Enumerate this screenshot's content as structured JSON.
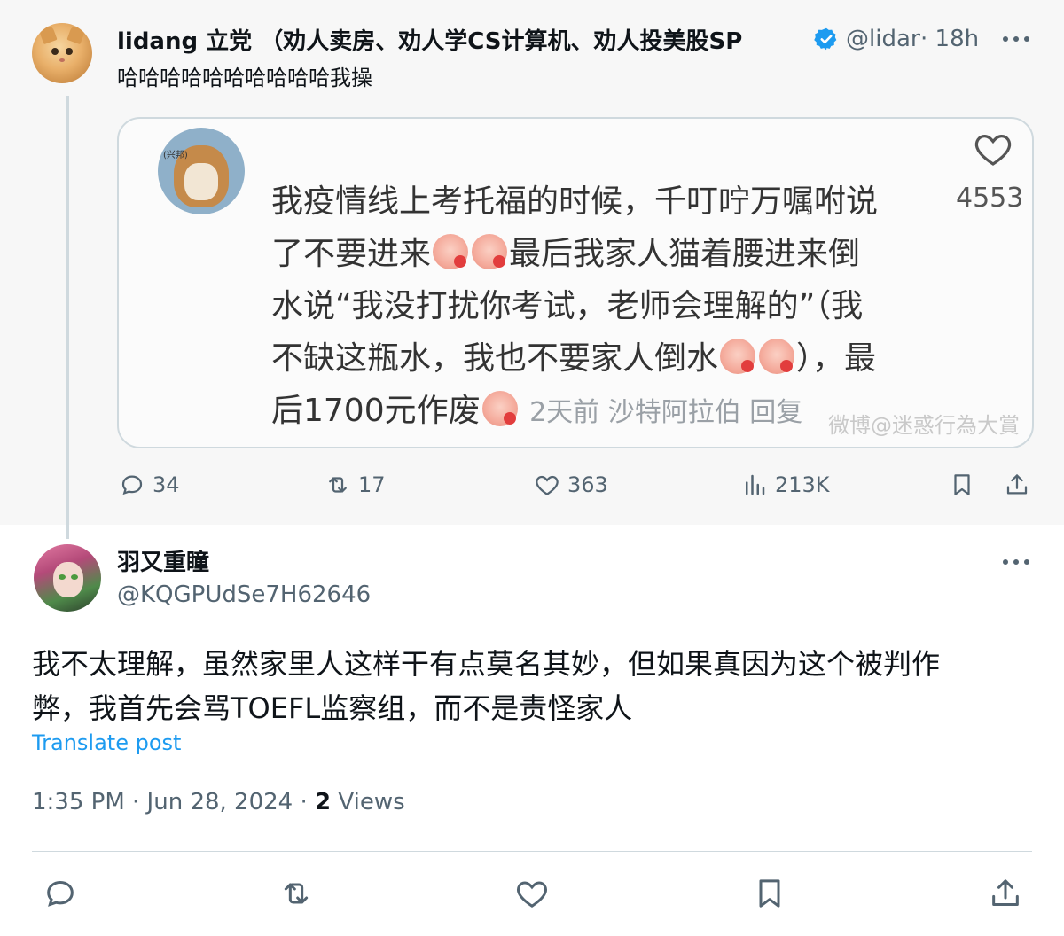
{
  "parent_tweet": {
    "display_name": "lidang 立党 （劝人卖房、劝人学CS计算机、劝人投美股SP",
    "handle": "@lidang",
    "time": "· 18h",
    "text": "哈哈哈哈哈哈哈哈哈哈我操",
    "media": {
      "avatar_tag": "(兴邦)",
      "line1": "我疫情线上考托福的时候，千叮咛万嘱咐说",
      "line2a": "了不要进来",
      "line2b": "最后我家人猫着腰进来倒",
      "line3": "水说“我没打扰你考试，老师会理解的”（我",
      "line4a": "不缺这瓶水，我也不要家人倒水",
      "line4b": "），最",
      "line5a": "后1700元作废",
      "line5_meta": "2天前 沙特阿拉伯 回复",
      "like_count": "4553",
      "watermark": "微博@迷惑行為大賞"
    },
    "stats": {
      "replies": "34",
      "reposts": "17",
      "likes": "363",
      "views": "213K"
    }
  },
  "reply_tweet": {
    "display_name": "羽又重瞳",
    "handle": "@KQGPUdSe7H62646",
    "text_line1": "我不太理解，虽然家里人这样干有点莫名其妙，但如果真因为这个被判作",
    "text_line2": "弊，我首先会骂TOEFL监察组，而不是责怪家人",
    "translate_label": "Translate post",
    "timestamp": "1:35 PM · Jun 28, 2024 · ",
    "view_count": "2",
    "view_label": " Views"
  },
  "colors": {
    "accent": "#1d9bf0",
    "secondary_text": "#536471",
    "primary_text": "#0f1419"
  }
}
